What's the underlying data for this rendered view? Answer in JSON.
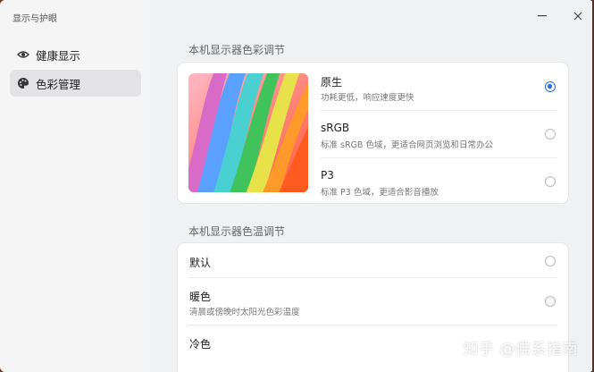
{
  "app": {
    "title": "显示与护眼"
  },
  "sidebar": {
    "items": [
      {
        "label": "健康显示",
        "icon": "eye-icon",
        "active": false
      },
      {
        "label": "色彩管理",
        "icon": "palette-icon",
        "active": true
      }
    ]
  },
  "window_controls": {
    "minimize": "minimize-icon",
    "close": "close-icon"
  },
  "color_section": {
    "title": "本机显示器色彩调节",
    "options": [
      {
        "label": "原生",
        "desc": "功耗更低，响应速度更快",
        "selected": true
      },
      {
        "label": "sRGB",
        "desc": "标准 sRGB 色域，更适合网页浏览和日常办公",
        "selected": false
      },
      {
        "label": "P3",
        "desc": "标准 P3 色域，更适合影音播放",
        "selected": false
      }
    ]
  },
  "temp_section": {
    "title": "本机显示器色温调节",
    "options": [
      {
        "label": "默认",
        "desc": "",
        "selected": false
      },
      {
        "label": "暖色",
        "desc": "清晨或傍晚时太阳光色彩温度",
        "selected": false
      },
      {
        "label": "冷色",
        "desc": "",
        "selected": false
      }
    ]
  },
  "watermark": "知乎 @佛系指南",
  "accent_color": "#2a6cf5"
}
